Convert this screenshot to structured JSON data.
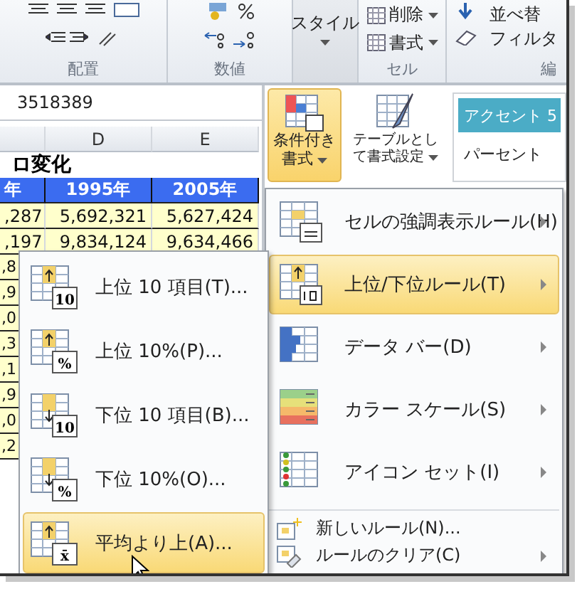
{
  "ribbon": {
    "groups": [
      {
        "kind": "alignment",
        "label": "配置"
      },
      {
        "kind": "number",
        "label": "数値"
      },
      {
        "kind": "style",
        "label": "スタイル"
      },
      {
        "kind": "cells",
        "label": "セル",
        "buttons": [
          "削除",
          "書式"
        ]
      },
      {
        "kind": "editing",
        "label": "編",
        "buttons": [
          "並べ替",
          "フィルタ"
        ]
      }
    ]
  },
  "formula_bar": {
    "value": "3518389"
  },
  "sheet": {
    "columns": [
      "",
      "D",
      "E"
    ],
    "title": "ロ変化",
    "header": [
      "年",
      "1995年",
      "2005年"
    ],
    "rows": [
      [
        ",287",
        "5,692,321",
        "5,627,424"
      ],
      [
        ",197",
        "9,834,124",
        "9,634,466"
      ]
    ],
    "edge_cells": [
      ",8",
      ",9",
      ",0",
      ",3",
      ",1",
      ",9",
      ",0",
      ",2"
    ]
  },
  "styles": {
    "buttons": [
      {
        "label": "条件付き書式",
        "selected": true
      },
      {
        "label": "テーブルとして書式設定",
        "selected": false
      }
    ],
    "gallery": [
      {
        "label": "アクセント 5",
        "kind": "accent"
      },
      {
        "label": "パーセント",
        "kind": "plain"
      }
    ]
  },
  "menu": [
    {
      "kind": "highlight",
      "label": "セルの強調表示ルール(H)",
      "selected": false,
      "submenu": true
    },
    {
      "kind": "topbottom",
      "label": "上位/下位ルール(T)",
      "selected": true,
      "submenu": true
    },
    {
      "kind": "databar",
      "label": "データ バー(D)",
      "selected": false,
      "submenu": true
    },
    {
      "kind": "colorscale",
      "label": "カラー スケール(S)",
      "selected": false,
      "submenu": true
    },
    {
      "kind": "iconset",
      "label": "アイコン セット(I)",
      "selected": false,
      "submenu": true
    },
    {
      "kind": "newrule",
      "label": "新しいルール(N)...",
      "selected": false,
      "submenu": false
    },
    {
      "kind": "clearrule",
      "label": "ルールのクリア(C)",
      "selected": false,
      "submenu": true
    }
  ],
  "submenu": [
    {
      "kind": "up",
      "badge": "10",
      "label": "上位 10 項目(T)...",
      "selected": false
    },
    {
      "kind": "up",
      "badge": "%",
      "label": "上位 10%(P)...",
      "selected": false
    },
    {
      "kind": "down",
      "badge": "10",
      "label": "下位 10 項目(B)...",
      "selected": false
    },
    {
      "kind": "down",
      "badge": "%",
      "label": "下位 10%(O)...",
      "selected": false
    },
    {
      "kind": "up",
      "badge": "x̄",
      "label": "平均より上(A)...",
      "selected": true
    }
  ]
}
